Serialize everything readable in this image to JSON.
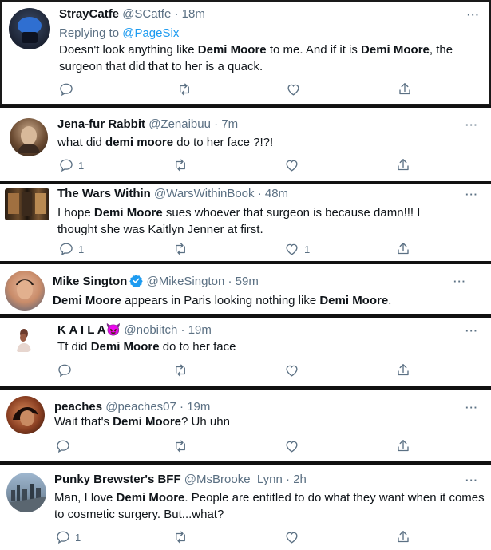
{
  "tweets": [
    {
      "name": "StrayCatfe",
      "handle": "@SCatfe",
      "sep": "·",
      "time": "18m",
      "reply_prefix": "Replying to ",
      "reply_to": "@PageSix",
      "text": [
        {
          "t": "Doesn't look anything like ",
          "b": false
        },
        {
          "t": "Demi Moore",
          "b": true
        },
        {
          "t": " to me. And if it is ",
          "b": false
        },
        {
          "t": "Demi Moore",
          "b": true
        },
        {
          "t": ", the surgeon that did that to her is a quack.",
          "b": false
        }
      ],
      "counts": {
        "reply": "",
        "retweet": "",
        "like": ""
      }
    },
    {
      "name": "Jena-fur Rabbit",
      "handle": "@Zenaibuu",
      "sep": "·",
      "time": "7m",
      "text": [
        {
          "t": "what did ",
          "b": false
        },
        {
          "t": "demi moore",
          "b": true
        },
        {
          "t": " do to her face ?!?!",
          "b": false
        }
      ],
      "counts": {
        "reply": "1",
        "retweet": "",
        "like": ""
      }
    },
    {
      "name": "The Wars Within",
      "handle": "@WarsWithinBook",
      "sep": "·",
      "time": "48m",
      "text": [
        {
          "t": "I hope ",
          "b": false
        },
        {
          "t": "Demi Moore",
          "b": true
        },
        {
          "t": " sues whoever that surgeon is because damn!!! I thought she was Kaitlyn Jenner at first.",
          "b": false
        }
      ],
      "counts": {
        "reply": "1",
        "retweet": "",
        "like": "1"
      }
    },
    {
      "name": "Mike Sington",
      "handle": "@MikeSington",
      "sep": "·",
      "time": "59m",
      "verified": true,
      "text": [
        {
          "t": "Demi Moore",
          "b": true
        },
        {
          "t": " appears in Paris looking nothing like ",
          "b": false
        },
        {
          "t": "Demi Moore",
          "b": true
        },
        {
          "t": ".",
          "b": false
        }
      ],
      "counts": {
        "reply": "",
        "retweet": "",
        "like": ""
      }
    },
    {
      "name": "K A I L A",
      "name_emoji": "😈",
      "handle": "@nobiitch",
      "sep": "·",
      "time": "19m",
      "text": [
        {
          "t": "Tf did ",
          "b": false
        },
        {
          "t": "Demi Moore",
          "b": true
        },
        {
          "t": " do to her face",
          "b": false
        }
      ],
      "counts": {
        "reply": "",
        "retweet": "",
        "like": ""
      }
    },
    {
      "name": "peaches",
      "handle": "@peaches07",
      "sep": "·",
      "time": "19m",
      "text": [
        {
          "t": "Wait that's ",
          "b": false
        },
        {
          "t": "Demi Moore",
          "b": true
        },
        {
          "t": "? Uh uhn",
          "b": false
        }
      ],
      "counts": {
        "reply": "",
        "retweet": "",
        "like": ""
      }
    },
    {
      "name": "Punky Brewster's BFF",
      "handle": "@MsBrooke_Lynn",
      "sep": "·",
      "time": "2h",
      "text": [
        {
          "t": "Man, I love ",
          "b": false
        },
        {
          "t": "Demi Moore",
          "b": true
        },
        {
          "t": ". People are entitled to do what they want when it comes to cosmetic surgery. But...what?",
          "b": false
        }
      ],
      "counts": {
        "reply": "1",
        "retweet": "",
        "like": ""
      }
    }
  ],
  "more_label": "···",
  "icons": {
    "reply": "reply-icon",
    "retweet": "retweet-icon",
    "like": "like-icon",
    "share": "share-icon",
    "more": "more-icon",
    "verified": "verified-badge-icon"
  },
  "colors": {
    "text": "#0f1419",
    "secondary": "#5b7083",
    "link": "#1d9bf0",
    "verified": "#1d9bf0",
    "divider": "#111111"
  }
}
